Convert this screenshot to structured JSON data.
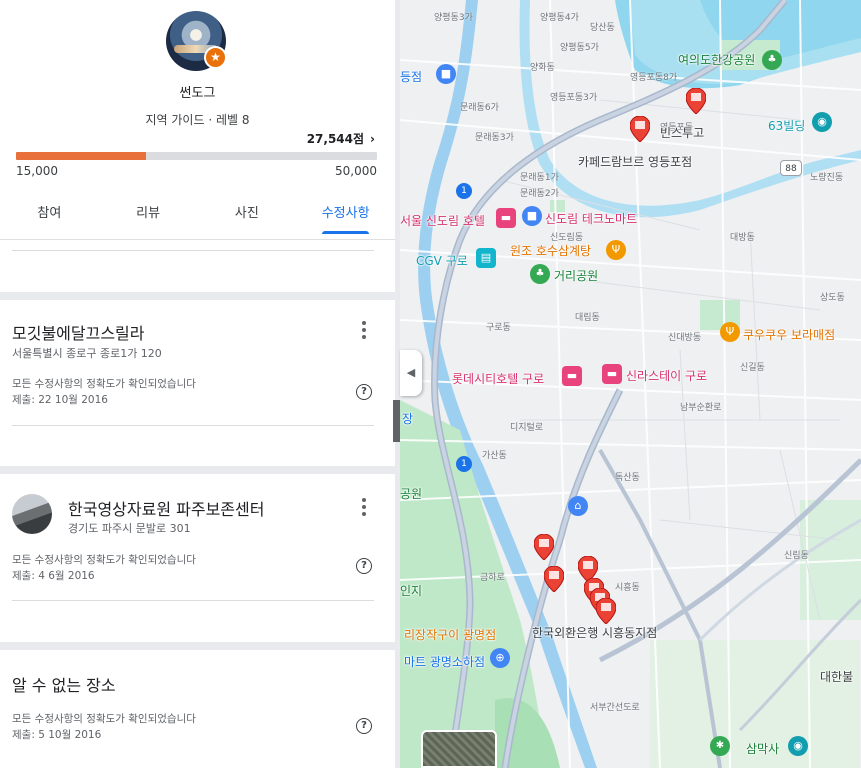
{
  "profile": {
    "name": "썬도그",
    "level_text": "지역 가이드 · 레벨 8",
    "points": "27,544점",
    "points_chevron": "›",
    "progress_fraction": 0.36,
    "progress_min": "15,000",
    "progress_max": "50,000",
    "badge_icon": "star-icon"
  },
  "tabs": [
    {
      "label": "참여"
    },
    {
      "label": "리뷰"
    },
    {
      "label": "사진"
    },
    {
      "label": "수정사항",
      "active": true
    }
  ],
  "edits": [
    {
      "title": "모깃불에달끄스릴라",
      "address": "서울특별시 종로구 종로1가 120",
      "status": "모든 수정사항의 정확도가 확인되었습니다",
      "date": "제출: 22 10월 2016"
    },
    {
      "title": "한국영상자료원 파주보존센터",
      "address": "경기도 파주시 문발로 301",
      "status": "모든 수정사항의 정확도가 확인되었습니다",
      "date": "제출: 4 6월 2016"
    },
    {
      "title": "알 수 없는 장소",
      "address": "",
      "status": "모든 수정사항의 정확도가 확인되었습니다",
      "date": "제출: 5 10월 2016"
    }
  ],
  "map": {
    "pois": [
      {
        "label": "여의도한강공원",
        "color": "green"
      },
      {
        "label": "63빌딩",
        "color": "teal"
      },
      {
        "label": "빈스투고",
        "color": "dark"
      },
      {
        "label": "카페드람브르 영등포점",
        "color": "dark"
      },
      {
        "label": "서울 신도림 호텔",
        "color": "pink"
      },
      {
        "label": "신도림 테크노마트",
        "color": "pink"
      },
      {
        "label": "원조 호수삼계탕",
        "color": "orange"
      },
      {
        "label": "CGV 구로",
        "color": "teal"
      },
      {
        "label": "거리공원",
        "color": "green"
      },
      {
        "label": "쿠우쿠우 보라매점",
        "color": "orange"
      },
      {
        "label": "롯데시티호텔 구로",
        "color": "pink"
      },
      {
        "label": "신라스테이 구로",
        "color": "pink"
      },
      {
        "label": "한국외환은행 시흥동지점",
        "color": "dark"
      },
      {
        "label": "리장작구이 광명점",
        "color": "orange"
      },
      {
        "label": "마트 광명소하점",
        "color": "blue"
      },
      {
        "label": "삼막사",
        "color": "green"
      },
      {
        "label": "대한불",
        "color": "dark"
      },
      {
        "label": "장",
        "color": "blue"
      },
      {
        "label": "등점",
        "color": "blue"
      },
      {
        "label": "공원",
        "color": "green"
      },
      {
        "label": "인지",
        "color": "green"
      }
    ],
    "districts": [
      "양평동3가",
      "양평동4가",
      "양평동5가",
      "영등포동8가",
      "영등포동",
      "영등포동3가",
      "문래동1가",
      "문래동2가",
      "문래동3가",
      "신도림동",
      "구로동",
      "대림동",
      "신대방동",
      "가산동",
      "독산동",
      "시흥동",
      "신림동",
      "남부순환로",
      "디지털로",
      "금하로",
      "서부간선도로",
      "대방동",
      "노량진동",
      "상도동",
      "문래동6가",
      "양화동",
      "당산동",
      "신길동"
    ],
    "route_badges": [
      "1",
      "88"
    ],
    "collapse_icon": "◀"
  }
}
